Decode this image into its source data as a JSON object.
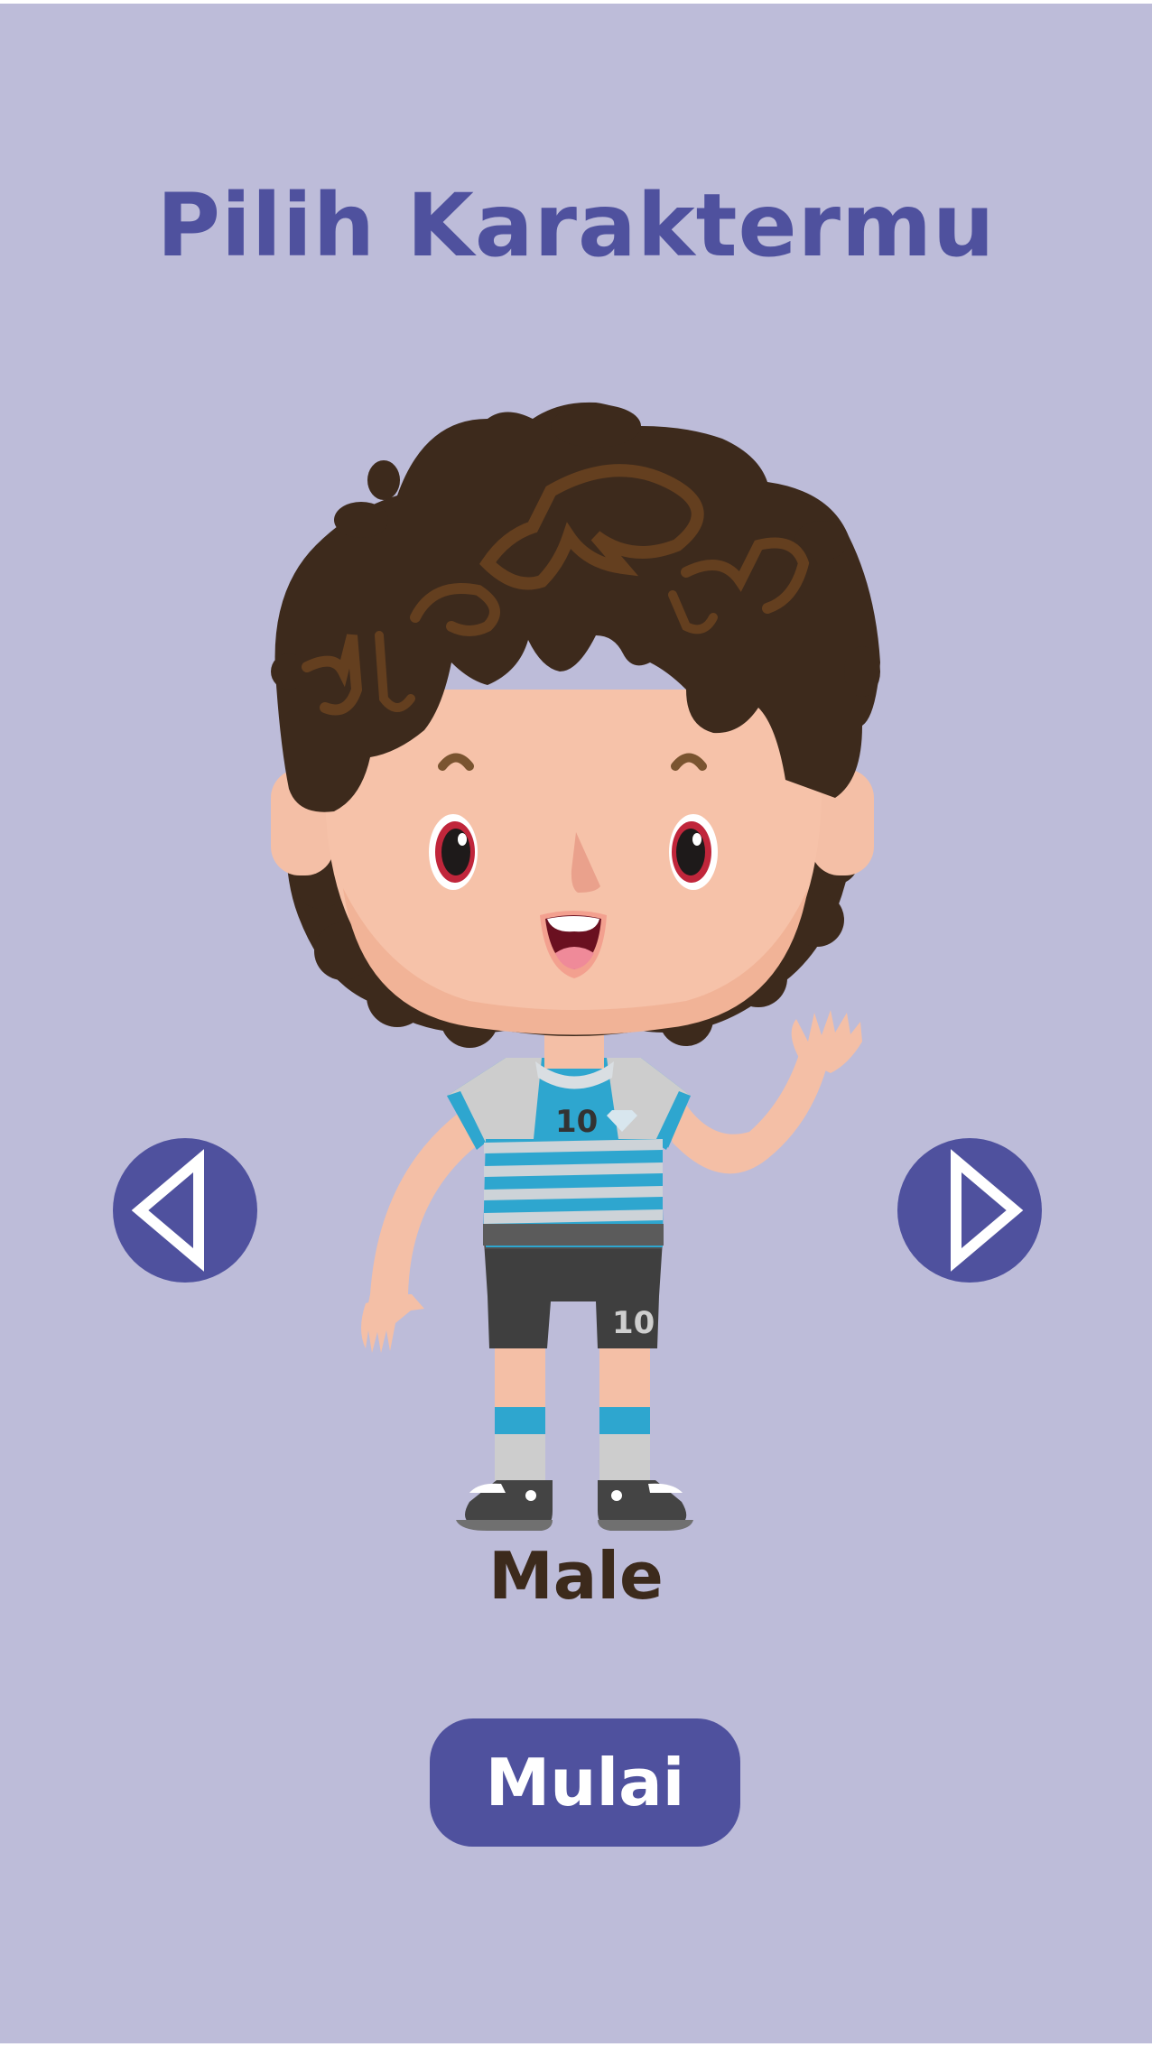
{
  "screen": {
    "title": "Pilih Karaktermu",
    "background_color": "#bdbcd9",
    "accent_color": "#4f519e"
  },
  "character": {
    "name": "Male",
    "jersey_number": "10",
    "illustration": "cartoon boy with curly brown hair in blue striped soccer jersey, waving"
  },
  "navigation": {
    "prev_icon": "triangle-left-icon",
    "next_icon": "triangle-right-icon"
  },
  "actions": {
    "start_label": "Mulai"
  }
}
